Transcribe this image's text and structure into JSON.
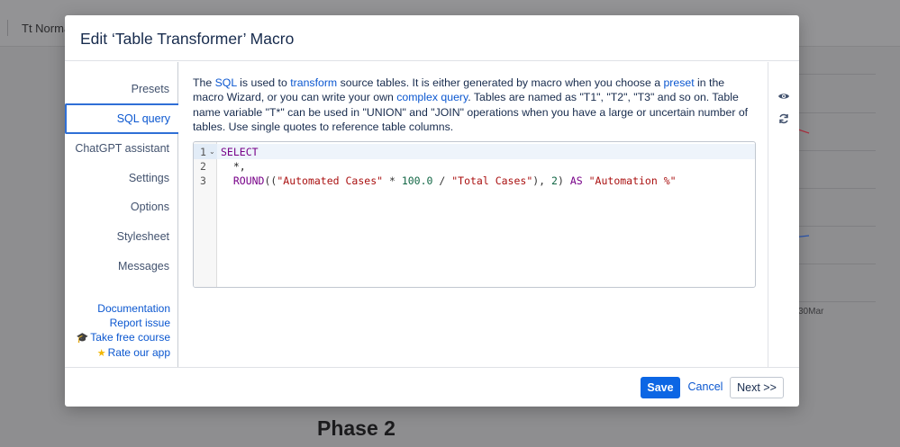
{
  "background": {
    "toolbar_format_label": "Tt Norma",
    "chart_axis_label": "30Mar",
    "heading": "Phase 2"
  },
  "modal": {
    "title": "Edit ‘Table Transformer’ Macro",
    "nav": {
      "presets": "Presets",
      "sql_query": "SQL query",
      "chatgpt": "ChatGPT assistant",
      "settings": "Settings",
      "options": "Options",
      "stylesheet": "Stylesheet",
      "messages": "Messages"
    },
    "links": {
      "documentation": "Documentation",
      "report_issue": "Report issue",
      "free_course": "Take free course",
      "rate_app": "Rate our app"
    },
    "description": {
      "p1": "The ",
      "sql": "SQL",
      "p2": " is used to ",
      "transform": "transform",
      "p3": " source tables. It is either generated by macro when you choose a ",
      "preset": "preset",
      "p4": " in the macro Wizard, or you can write your own ",
      "complex_query": "complex query",
      "p5": ". Tables are named as \"T1\", \"T2\", \"T3\" and so on. Table name variable \"T*\" can be used in \"UNION\" and \"JOIN\" operations when you have a large or uncertain number of tables. Use single quotes to reference table columns."
    },
    "editor": {
      "line_numbers": [
        "1",
        "2",
        "3"
      ],
      "line1": "SELECT",
      "line2": "  *,",
      "line3_fn": "ROUND",
      "line3_open": "((",
      "line3_str1": "\"Automated Cases\"",
      "line3_op1": " * ",
      "line3_num1": "100.0",
      "line3_op2": " / ",
      "line3_str2": "\"Total Cases\"",
      "line3_mid": "), ",
      "line3_num2": "2",
      "line3_close": ") ",
      "line3_kw": "AS",
      "line3_sp": " ",
      "line3_str3": "\"Automation %\""
    },
    "footer": {
      "save": "Save",
      "cancel": "Cancel",
      "next": "Next >>"
    },
    "icons": {
      "preview": "eye-icon",
      "refresh": "refresh-icon"
    }
  }
}
